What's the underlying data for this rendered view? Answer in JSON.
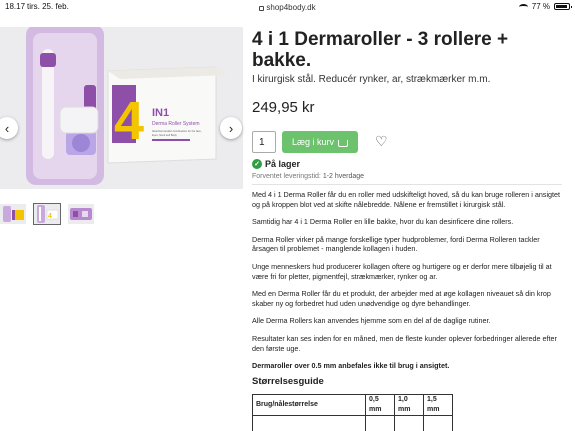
{
  "status_bar": {
    "time": "18.17",
    "date": "tirs. 25. feb.",
    "url": "shop4body.dk",
    "battery": "77 %"
  },
  "product": {
    "title": "4 i 1 Dermaroller - 3 rollere + bakke.",
    "subtitle": "I kirurgisk stål. Reducér rynker, ar, strækmærker m.m.",
    "price": "249,95 kr",
    "quantity": "1",
    "add_to_cart_label": "Læg i kurv",
    "stock_label": "På lager",
    "delivery_prefix": "Forventet leveringstid:",
    "delivery_time": "1-2 hverdage"
  },
  "box_print": {
    "big": "4",
    "in1": "IN1",
    "name": "Derma Roller System",
    "line1": "Ideal Dermaroller Combination for the face,",
    "line2": "Eyes, Neck and Body"
  },
  "description": {
    "paragraphs": [
      "Med 4 i 1 Derma Roller får du en roller med udskifteligt hoved, så du kan bruge rolleren i ansigtet og på kroppen blot ved at skifte nålebredde. Nålene er fremstillet i kirurgisk stål.",
      "Samtidig har 4 i 1 Derma Roller en lille bakke, hvor du kan desinficere dine rollers.",
      "Derma Roller virker på mange forskellige typer hudproblemer, fordi Derma Rolleren tackler årsagen til problemet - manglende kollagen i huden.",
      "Unge menneskers hud producerer kollagen oftere og hurtigere og er derfor mere tilbøjelig til at være fri for pletter, pigmentfejl, strækmærker, rynker og ar.",
      "Med en Derma Roller får du et produkt, der arbejder med at øge kollagen niveauet så din krop skaber ny og forbedret hud uden unødvendige og dyre behandlinger.",
      "Alle Derma Rollers kan anvendes hjemme som en del af de daglige rutiner.",
      "Resultater kan ses inden for en måned, men de fleste kunder oplever forbedringer allerede efter den første uge."
    ],
    "warning": "Dermaroller over 0.5 mm anbefales ikke til brug i ansigtet.",
    "size_guide_heading": "Størrelsesguide",
    "size_table": {
      "headers": [
        "Brug/nålestørrelse",
        "0,5 mm",
        "1,0 mm",
        "1,5 mm"
      ]
    }
  },
  "icons": {
    "prev": "chevron-left-icon",
    "next": "chevron-right-icon",
    "cart": "cart-icon",
    "wishlist": "heart-icon",
    "stock": "check-circle-icon"
  },
  "colors": {
    "accent_green": "#6dc36d",
    "stock_green": "#2f9e44",
    "roller_purple": "#8e4fa8",
    "box_yellow": "#f2c500"
  }
}
